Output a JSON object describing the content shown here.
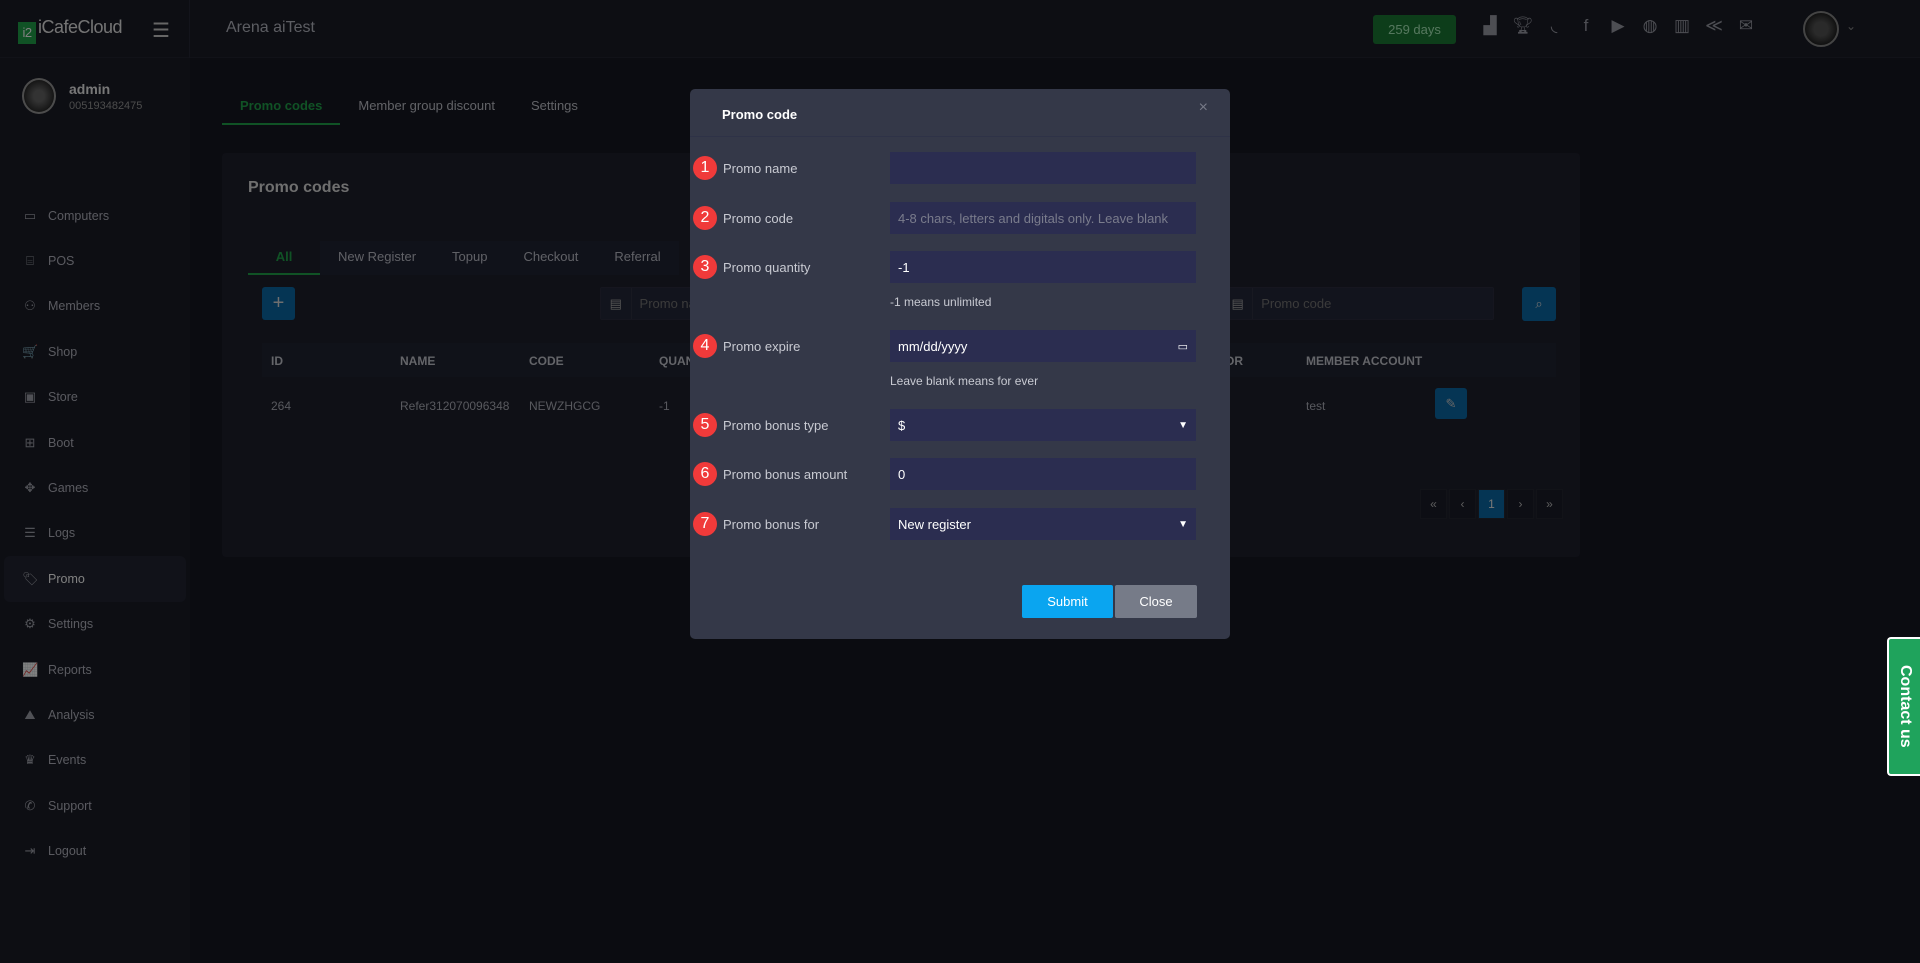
{
  "topbar": {
    "logo": "iCafeCloud",
    "cafe": "Arena aiTest",
    "days": "259 days",
    "icons": [
      "ranking-icon",
      "trophy-icon",
      "rss-icon",
      "facebook-icon",
      "youtube-icon",
      "globe-icon",
      "icafe-icon",
      "wiki-icon",
      "mail-icon"
    ]
  },
  "user": {
    "name": "admin",
    "id": "005193482475"
  },
  "sidebar": {
    "items": [
      {
        "label": "Computers",
        "icon": "▭"
      },
      {
        "label": "POS",
        "icon": "⌸"
      },
      {
        "label": "Members",
        "icon": "⚇"
      },
      {
        "label": "Shop",
        "icon": "🛒"
      },
      {
        "label": "Store",
        "icon": "▣"
      },
      {
        "label": "Boot",
        "icon": "⊞"
      },
      {
        "label": "Games",
        "icon": "✥"
      },
      {
        "label": "Logs",
        "icon": "☰"
      },
      {
        "label": "Promo",
        "icon": "🏷"
      },
      {
        "label": "Settings",
        "icon": "⚙"
      },
      {
        "label": "Reports",
        "icon": "📈"
      },
      {
        "label": "Analysis",
        "icon": "⛰"
      },
      {
        "label": "Events",
        "icon": "♛"
      },
      {
        "label": "Support",
        "icon": "✆"
      },
      {
        "label": "Logout",
        "icon": "⇥"
      }
    ]
  },
  "page_tabs": [
    "Promo codes",
    "Member group discount",
    "Settings"
  ],
  "card": {
    "title": "Promo codes",
    "sub_tabs": [
      "All",
      "New Register",
      "Topup",
      "Checkout",
      "Referral"
    ],
    "search_name_placeholder": "Promo name",
    "search_code_placeholder": "Promo code",
    "columns": [
      "ID",
      "NAME",
      "CODE",
      "QUANTITY",
      "OR",
      "MEMBER ACCOUNT"
    ],
    "rows": [
      {
        "id": "264",
        "name": "Refer312070096348",
        "code": "NEWZHGCG",
        "quantity": "-1",
        "member": "test"
      }
    ],
    "pager": [
      "«",
      "‹",
      "1",
      "›",
      "»"
    ]
  },
  "contact": "Contact us",
  "modal": {
    "title": "Promo code",
    "close": "×",
    "fields": [
      {
        "n": "1",
        "label": "Promo name",
        "value": ""
      },
      {
        "n": "2",
        "label": "Promo code",
        "placeholder": "4-8 chars, letters and digitals only. Leave blank"
      },
      {
        "n": "3",
        "label": "Promo quantity",
        "value": "-1",
        "help": "-1 means unlimited"
      },
      {
        "n": "4",
        "label": "Promo expire",
        "value": "mm/dd/yyyy",
        "help": "Leave blank means for ever"
      },
      {
        "n": "5",
        "label": "Promo bonus type",
        "value": "$"
      },
      {
        "n": "6",
        "label": "Promo bonus amount",
        "value": "0"
      },
      {
        "n": "7",
        "label": "Promo bonus for",
        "value": "New register"
      }
    ],
    "submit": "Submit",
    "close_btn": "Close"
  }
}
